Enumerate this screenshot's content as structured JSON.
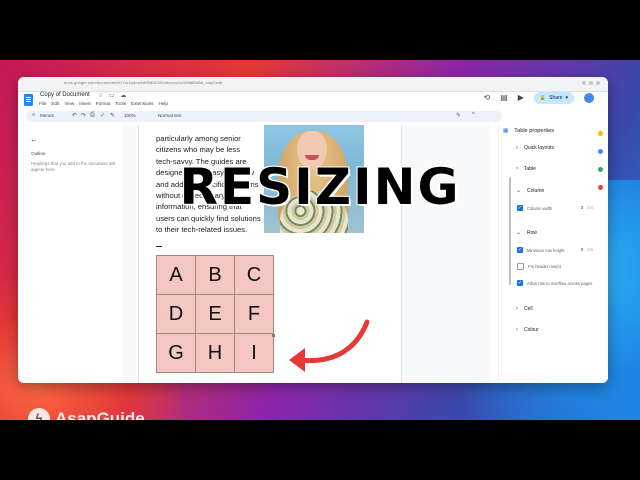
{
  "overlay": {
    "title": "RESIZING",
    "brand": "AsapGuide"
  },
  "browser": {
    "url": "docs.google.com/document/d/1Ysl4pdcw4WRBVL5Zn4bouvo0o1fMdiEkBb_odqGedit"
  },
  "doc": {
    "title": "Copy of Document",
    "menu": [
      "File",
      "Edit",
      "View",
      "Insert",
      "Format",
      "Tools",
      "Extensions",
      "Help"
    ],
    "share_label": "Share",
    "toolbar": {
      "menus_label": "Menus",
      "zoom": "100%",
      "style": "Normal text"
    }
  },
  "outline": {
    "title": "Outline",
    "hint": "Headings that you add to the document will appear here."
  },
  "body_lines": [
    "particularly among senior",
    "citizens who may be less",
    "tech-savvy. The guides are",
    "designed to be easy to follow",
    "and address specific problems",
    "without unnecessary",
    "information, ensuring that",
    "users can quickly find solutions",
    "to their tech-related issues."
  ],
  "table": {
    "cells": [
      "A",
      "B",
      "C",
      "D",
      "E",
      "F",
      "G",
      "H",
      "I"
    ]
  },
  "properties": {
    "title": "Table properties",
    "sections": {
      "quick_layouts": "Quick layouts",
      "table": "Table",
      "column": "Column",
      "row": "Row",
      "cell": "Cell",
      "colour": "Colour"
    },
    "column_width_label": "Column width",
    "column_width_value": "3",
    "min_row_height_label": "Minimum row height",
    "min_row_height_value": "0",
    "pin_header_label": "Pin header row(s)",
    "overflow_label": "Allow row to overflow across pages",
    "unit": "cm"
  },
  "colors": {
    "table_fill": "#f4c7c3",
    "accent": "#1a73e8",
    "arrow": "#e53935"
  }
}
